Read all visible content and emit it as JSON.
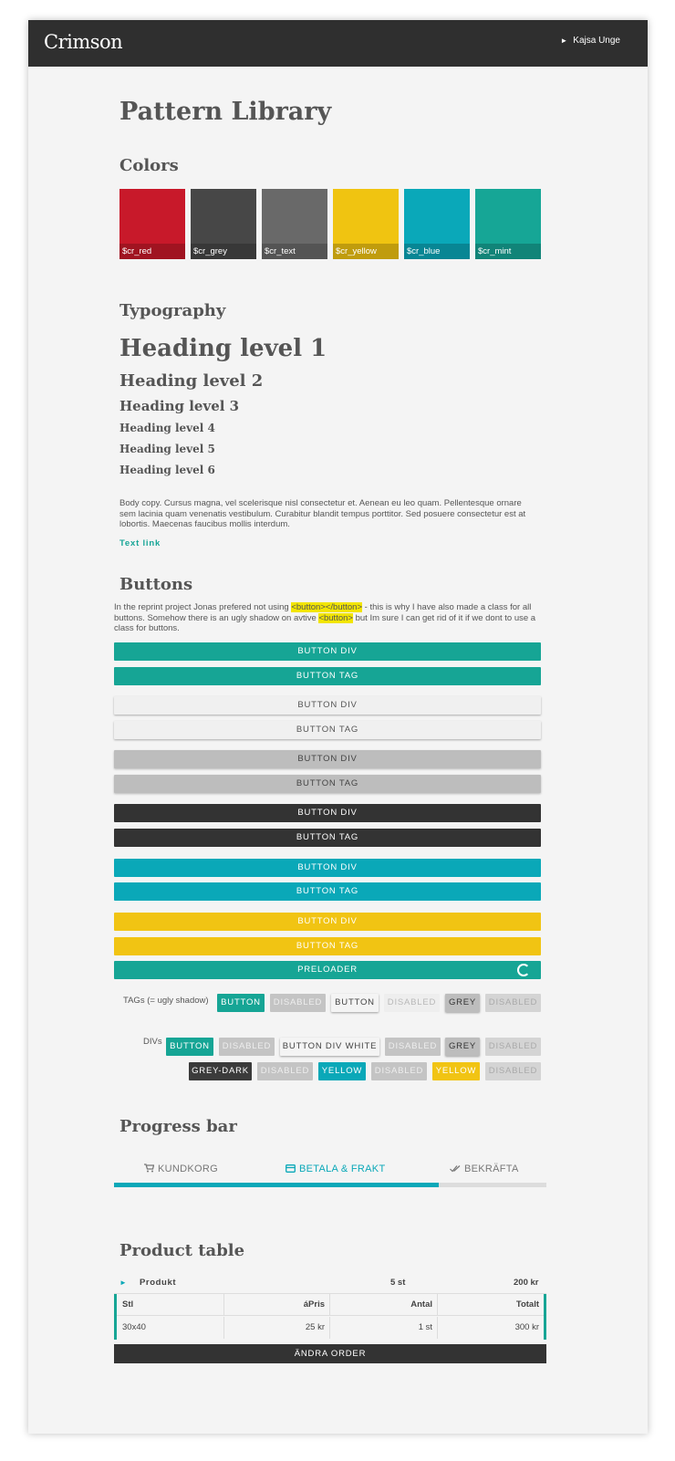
{
  "header": {
    "logo": "Crimson",
    "user": "Kajsa Unge"
  },
  "page_title": "Pattern Library",
  "colors": {
    "title": "Colors",
    "swatches": [
      {
        "name": "$cr_red",
        "hex": "#c8192a"
      },
      {
        "name": "$cr_grey",
        "hex": "#474747"
      },
      {
        "name": "$cr_text",
        "hex": "#696969"
      },
      {
        "name": "$cr_yellow",
        "hex": "#f0c411"
      },
      {
        "name": "$cr_blue",
        "hex": "#0aa8b9"
      },
      {
        "name": "$cr_mint",
        "hex": "#16a696"
      }
    ]
  },
  "typography": {
    "title": "Typography",
    "headings": [
      "Heading level 1",
      "Heading level 2",
      "Heading level 3",
      "Heading level 4",
      "Heading level 5",
      "Heading level 6"
    ],
    "body": "Body copy. Cursus magna, vel scelerisque nisl consectetur et. Aenean eu leo quam. Pellentesque ornare sem lacinia quam venenatis vestibulum. Curabitur blandit tempus porttitor. Sed posuere consectetur est at lobortis. Maecenas faucibus mollis interdum.",
    "link": "Text link"
  },
  "buttons": {
    "title": "Buttons",
    "intro_1": "In the reprint project Jonas prefered not using ",
    "code_1": "<button></button>",
    "intro_2": " - this is why I have also made a class for all buttons. Somehow there is an ugly shadow on avtive ",
    "code_2": "<button>",
    "intro_3": " but Im sure I can get rid of it if we dont to use a class for buttons.",
    "full": [
      "BUTTON DIV",
      "BUTTON TAG",
      "BUTTON DIV",
      "BUTTON TAG",
      "BUTTON DIV",
      "BUTTON TAG",
      "BUTTON DIV",
      "BUTTON TAG",
      "BUTTON DIV",
      "BUTTON TAG",
      "BUTTON DIV",
      "BUTTON TAG"
    ],
    "preloader": "PRELOADER",
    "tags_label": "TAGs (= ugly shadow)",
    "tags": [
      "BUTTON",
      "DISABLED",
      "BUTTON",
      "DISABLED",
      "GREY",
      "DISABLED"
    ],
    "divs_label": "DIVs",
    "divs_row1": [
      "BUTTON",
      "DISABLED",
      "BUTTON DIV WHITE",
      "DISABLED",
      "GREY",
      "DISABLED"
    ],
    "divs_row2": [
      "GREY-DARK",
      "DISABLED",
      "YELLOW",
      "DISABLED",
      "YELLOW",
      "DISABLED"
    ]
  },
  "progress": {
    "title": "Progress bar",
    "steps": [
      "KUNDKORG",
      "BETALA & FRAKT",
      "BEKRÄFTA"
    ],
    "active_step": 1,
    "fill_fraction": 0.75
  },
  "product_table": {
    "title": "Product table",
    "summary": {
      "product": "Produkt",
      "qty": "5 st",
      "price": "200 kr"
    },
    "headers": [
      "Stl",
      "áPris",
      "Antal",
      "Totalt"
    ],
    "row": [
      "30x40",
      "25 kr",
      "1 st",
      "300 kr"
    ],
    "action": "ÄNDRA ORDER"
  }
}
